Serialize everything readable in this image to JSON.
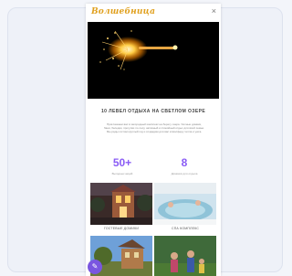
{
  "header": {
    "logo": "Волшебница",
    "close_icon": "close-icon"
  },
  "section": {
    "title": "10 ЛЕВЕЛ ОТДЫХА НА СВЕТЛОМ ОЗЕРЕ",
    "paragraph": "Приглашаем вас в загородный комплекс на берегу озера. Уютные домики, баня, беседки, прогулки по лесу, активный и спокойный отдых для всей семьи. Мы рады гостям круглый год и создадим для вас атмосферу тепла и уюта."
  },
  "stats": [
    {
      "value": "50+",
      "label": "Выгодных акций"
    },
    {
      "value": "8",
      "label": "Домиков для отдыха"
    }
  ],
  "gallery": [
    {
      "caption": "ГОСТЕВЫЕ ДОМИКИ"
    },
    {
      "caption": "СПА КОМПЛЕКС"
    }
  ],
  "colors": {
    "accent": "#8a5cf5",
    "logo": "#e0a01e"
  }
}
